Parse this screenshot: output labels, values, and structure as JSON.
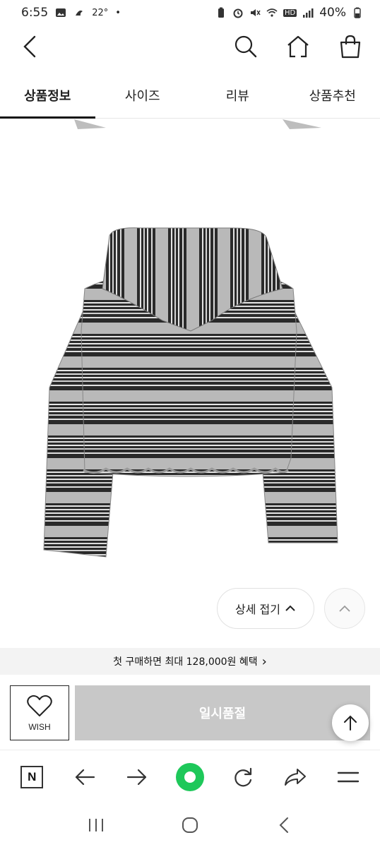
{
  "status_bar": {
    "time": "6:55",
    "temperature": "22°",
    "dot": "•",
    "network_hd": "HD",
    "battery": "40%"
  },
  "header": {
    "icons": [
      "back-icon",
      "search-icon",
      "home-icon",
      "shopping-bag-icon"
    ]
  },
  "tabs": [
    {
      "label": "상품정보",
      "active": true
    },
    {
      "label": "사이즈",
      "active": false
    },
    {
      "label": "리뷰",
      "active": false
    },
    {
      "label": "상품추천",
      "active": false
    }
  ],
  "detail": {
    "toggle_label": "상세 접기"
  },
  "promo": {
    "text": "첫 구매하면 최대 128,000원 혜택",
    "chevron": "›"
  },
  "buy_bar": {
    "wish_label": "WISH",
    "soldout_label": "일시품절"
  },
  "browser_toolbar": {
    "n_label": "N"
  },
  "colors": {
    "soldout_bg": "#c8c8c8",
    "promo_bg": "#f3f3f3",
    "browser_accent": "#1ec85a"
  }
}
